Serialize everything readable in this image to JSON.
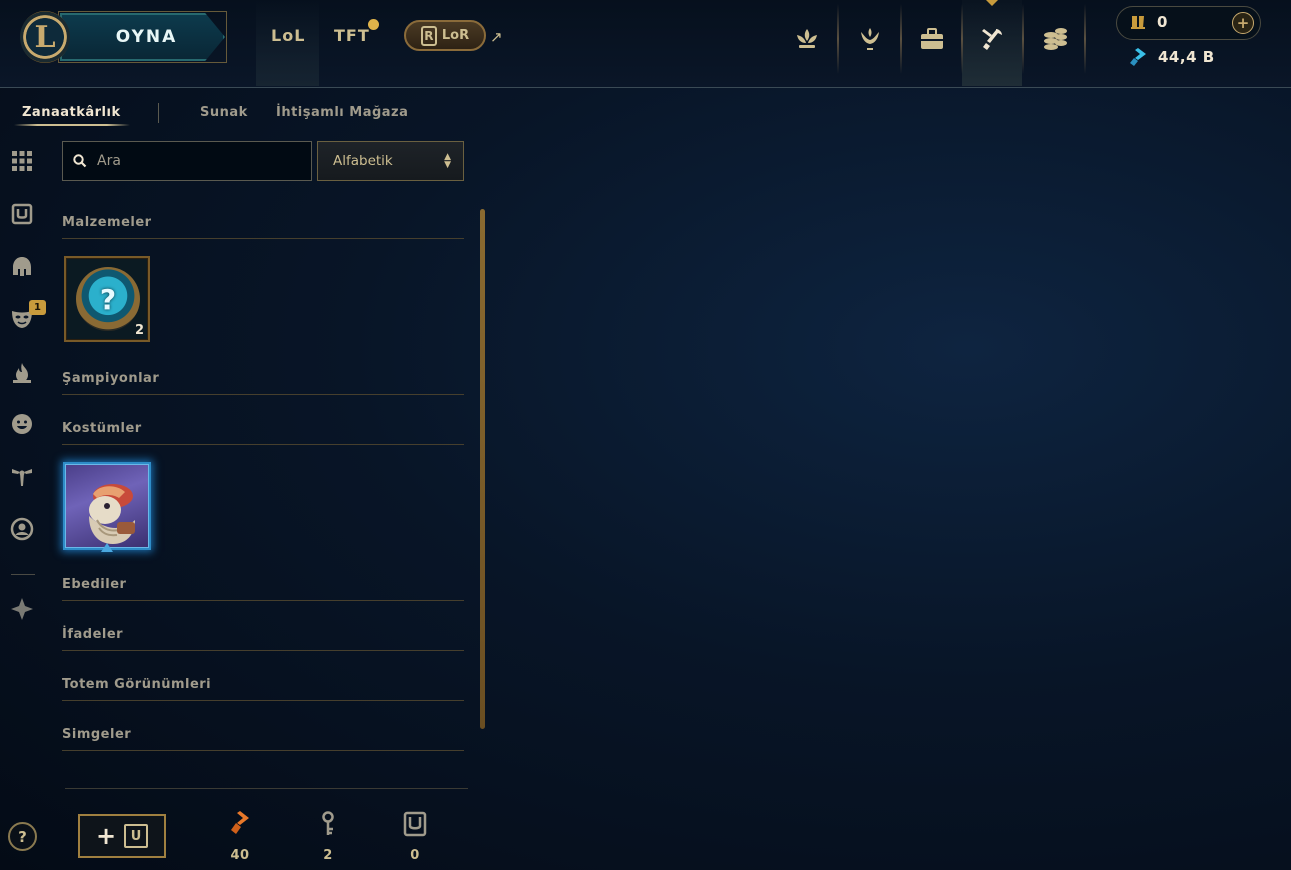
{
  "header": {
    "logo_letter": "L",
    "play_label": "OYNA",
    "tabs": [
      {
        "label": "LoL"
      },
      {
        "label": "TFT",
        "has_notification": true
      },
      {
        "label": "LoR",
        "external": true
      }
    ],
    "icons": [
      "profile-lotus-icon",
      "honor-icon",
      "collection-icon",
      "loot-crafting-icon",
      "store-coins-icon"
    ],
    "active_icon": "loot-crafting-icon",
    "currency": {
      "rp": "0",
      "be": "44,4 B",
      "add_label": "+"
    }
  },
  "subtabs": [
    {
      "label": "Zanaatkârlık",
      "active": true
    },
    {
      "label": "Sunak"
    },
    {
      "label": "İhtişamlı Mağaza"
    }
  ],
  "sidebar": {
    "icons": [
      "grid-icon",
      "chest-icon",
      "helmet-icon",
      "mask-icon",
      "flame-icon",
      "emote-icon",
      "ward-icon",
      "profile-icon",
      "eternal-icon"
    ],
    "badge": "1",
    "help_label": "?"
  },
  "search": {
    "placeholder": "Ara",
    "value": ""
  },
  "sort": {
    "label": "Alfabetik"
  },
  "sections": [
    {
      "title": "Malzemeler",
      "items": [
        {
          "type": "mystery-orb",
          "count": "2"
        }
      ]
    },
    {
      "title": "Şampiyonlar"
    },
    {
      "title": "Kostümler",
      "items": [
        {
          "type": "skin"
        }
      ]
    },
    {
      "title": "Ebediler"
    },
    {
      "title": "İfadeler"
    },
    {
      "title": "Totem Görünümleri"
    },
    {
      "title": "Simgeler"
    }
  ],
  "footer": {
    "reroll_plus": "+",
    "counts": [
      {
        "icon": "orange-essence-icon",
        "value": "40"
      },
      {
        "icon": "key-icon",
        "value": "2"
      },
      {
        "icon": "chest-icon",
        "value": "0"
      }
    ]
  },
  "colors": {
    "gold": "#c8aa6e",
    "text": "#cdbe91",
    "bg": "#081527",
    "accent_blue": "#2e8cc8",
    "orange": "#e8782a"
  }
}
